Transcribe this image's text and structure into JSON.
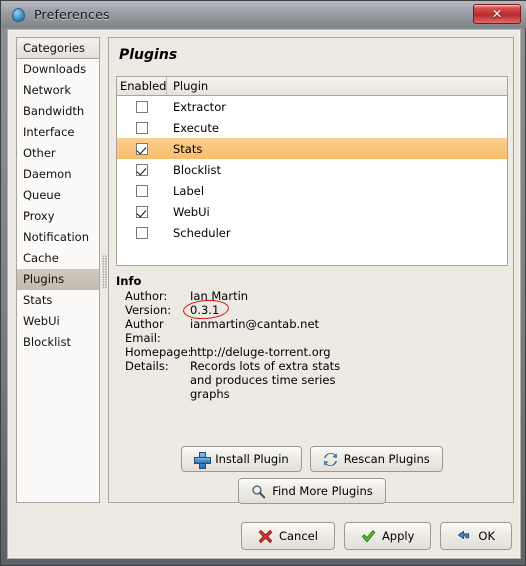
{
  "window": {
    "title": "Preferences",
    "title_icon": "deluge-drop-icon",
    "close_label": "✕"
  },
  "sidebar": {
    "header": "Categories",
    "items": [
      {
        "label": "Downloads",
        "selected": false
      },
      {
        "label": "Network",
        "selected": false
      },
      {
        "label": "Bandwidth",
        "selected": false
      },
      {
        "label": "Interface",
        "selected": false
      },
      {
        "label": "Other",
        "selected": false
      },
      {
        "label": "Daemon",
        "selected": false
      },
      {
        "label": "Queue",
        "selected": false
      },
      {
        "label": "Proxy",
        "selected": false
      },
      {
        "label": "Notification",
        "selected": false
      },
      {
        "label": "Cache",
        "selected": false
      },
      {
        "label": "Plugins",
        "selected": true
      },
      {
        "label": "Stats",
        "selected": false
      },
      {
        "label": "WebUi",
        "selected": false
      },
      {
        "label": "Blocklist",
        "selected": false
      }
    ]
  },
  "panel": {
    "title": "Plugins",
    "columns": [
      "Enabled",
      "Plugin"
    ],
    "rows": [
      {
        "name": "Extractor",
        "enabled": false,
        "selected": false
      },
      {
        "name": "Execute",
        "enabled": false,
        "selected": false
      },
      {
        "name": "Stats",
        "enabled": true,
        "selected": true
      },
      {
        "name": "Blocklist",
        "enabled": true,
        "selected": false
      },
      {
        "name": "Label",
        "enabled": false,
        "selected": false
      },
      {
        "name": "WebUi",
        "enabled": true,
        "selected": false
      },
      {
        "name": "Scheduler",
        "enabled": false,
        "selected": false
      }
    ]
  },
  "info": {
    "title": "Info",
    "author_label": "Author:",
    "author_value": "Ian Martin",
    "version_label": "Version:",
    "version_value": "0.3.1",
    "email_label": "Author Email:",
    "email_value": "ianmartin@cantab.net",
    "homepage_label": "Homepage:",
    "homepage_value": "http://deluge-torrent.org",
    "details_label": "Details:",
    "details_line1": "Records lots of extra stats",
    "details_line2": "and produces time series",
    "details_line3": "graphs"
  },
  "annotation": {
    "shape": "red-ellipse",
    "targets": "version_value",
    "color": "#cc1414"
  },
  "actions": {
    "install": {
      "label": "Install Plugin",
      "icon": "plus-icon"
    },
    "rescan": {
      "label": "Rescan Plugins",
      "icon": "refresh-icon"
    },
    "find_more": {
      "label": "Find More Plugins",
      "icon": "search-icon"
    }
  },
  "dialog_buttons": {
    "cancel": {
      "label": "Cancel",
      "icon": "red-x-icon"
    },
    "apply": {
      "label": "Apply",
      "icon": "green-check-icon"
    },
    "ok": {
      "label": "OK",
      "icon": "blue-arrow-icon"
    }
  },
  "colors": {
    "selection_row": "#f8bd6a",
    "sidebar_selection": "#c8c0b4",
    "window_bg": "#edeae4",
    "annotation": "#cc1414"
  }
}
